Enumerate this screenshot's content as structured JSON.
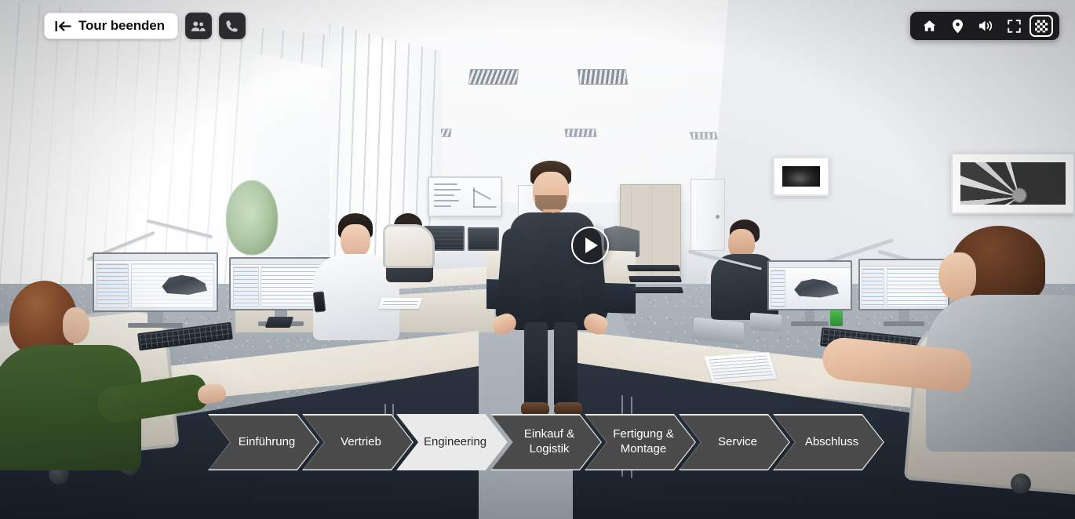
{
  "app": {
    "title": "Virtuelle Tour",
    "active_station": "Engineering"
  },
  "top_left": {
    "exit_button": {
      "label": "Tour beenden",
      "icon": "skip-to-start-icon"
    },
    "buttons": [
      {
        "name": "participants-button",
        "icon": "people-icon",
        "label": "Teilnehmer"
      },
      {
        "name": "call-button",
        "icon": "phone-icon",
        "label": "Anruf"
      }
    ]
  },
  "top_right": {
    "buttons": [
      {
        "name": "home-button",
        "icon": "home-icon",
        "label": "Home",
        "active": false
      },
      {
        "name": "map-button",
        "icon": "map-pin-icon",
        "label": "Karte",
        "active": false
      },
      {
        "name": "sound-button",
        "icon": "volume-icon",
        "label": "Ton",
        "active": false
      },
      {
        "name": "fullscreen-button",
        "icon": "fullscreen-icon",
        "label": "Vollbild",
        "active": false
      },
      {
        "name": "scenes-button",
        "icon": "checkerboard-icon",
        "label": "Szenen",
        "active": true
      }
    ]
  },
  "viewer": {
    "play_button_label": "Video abspielen",
    "play_icon": "play-icon"
  },
  "nav": {
    "stations": [
      {
        "label": "Einführung",
        "active": false,
        "width": "narrow"
      },
      {
        "label": "Vertrieb",
        "active": false,
        "width": "narrow"
      },
      {
        "label": "Engineering",
        "active": true,
        "width": "narrow"
      },
      {
        "label": "Einkauf &\nLogistik",
        "active": false,
        "width": "narrow"
      },
      {
        "label": "Fertigung &\nMontage",
        "active": false,
        "width": "narrow"
      },
      {
        "label": "Service",
        "active": false,
        "width": "narrow"
      },
      {
        "label": "Abschluss",
        "active": false,
        "width": "narrow"
      }
    ]
  },
  "colors": {
    "chevron_inactive_bg": "#4a4a4a",
    "chevron_active_bg": "#eaeaea",
    "chevron_border": "#e9e9e9",
    "chevron_text": "#ffffff",
    "chevron_active_text": "#2a2a2a",
    "control_bar_bg": "#1b1b1d",
    "icon_button_bg": "#2b2b2d",
    "exit_button_bg": "#ffffff",
    "exit_button_text": "#0d0f11"
  }
}
